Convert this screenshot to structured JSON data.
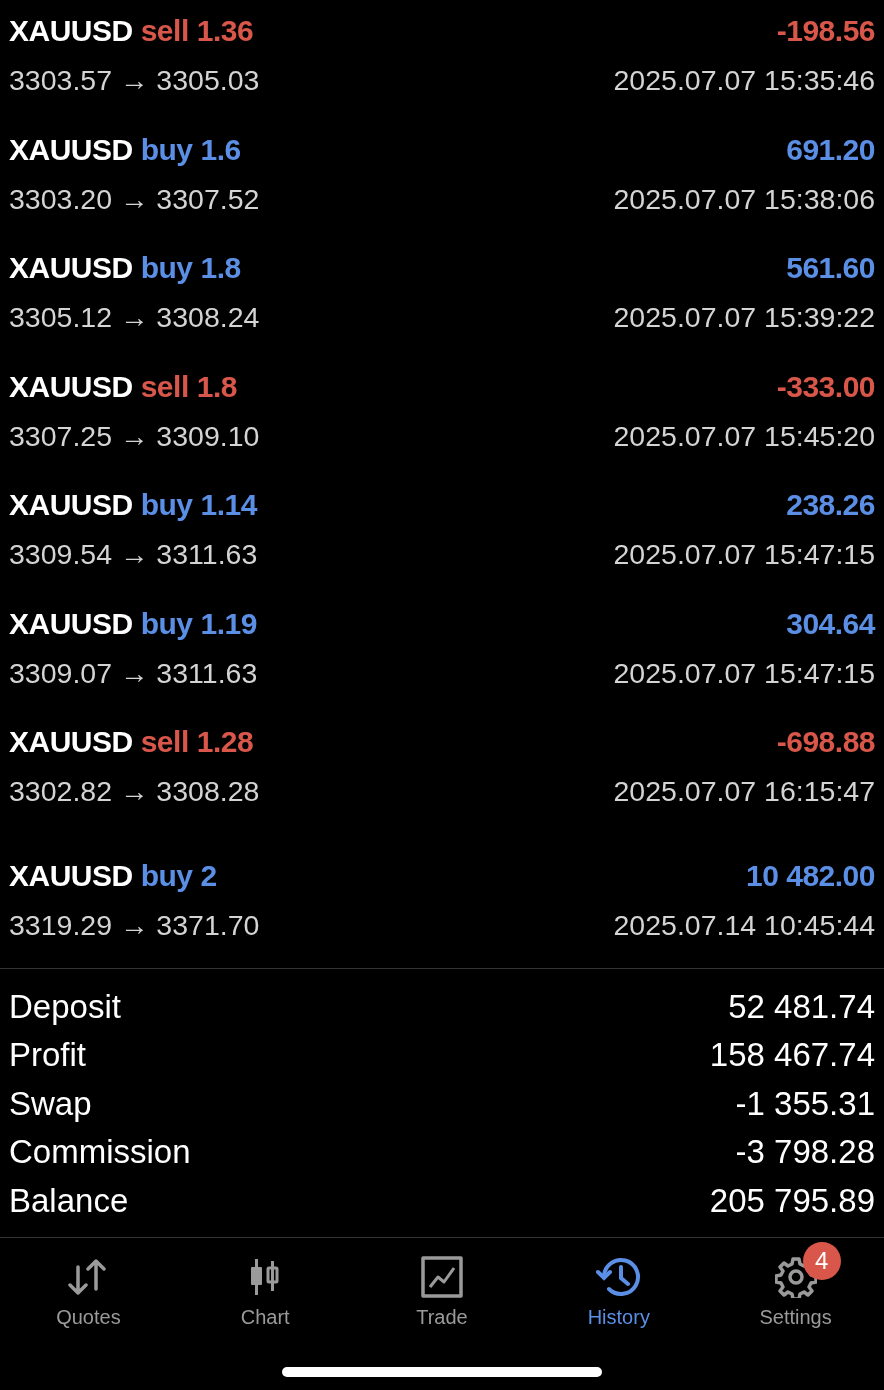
{
  "deals": [
    {
      "symbol": "XAUUSD",
      "side": "sell",
      "kind": "sell",
      "volume": "1.36",
      "profit": "-198.56",
      "prices": "3303.57 → 3305.03",
      "time": "2025.07.07 15:35:46"
    },
    {
      "symbol": "XAUUSD",
      "side": "buy",
      "kind": "buy",
      "volume": "1.6",
      "profit": "691.20",
      "prices": "3303.20 → 3307.52",
      "time": "2025.07.07 15:38:06"
    },
    {
      "symbol": "XAUUSD",
      "side": "buy",
      "kind": "buy",
      "volume": "1.8",
      "profit": "561.60",
      "prices": "3305.12 → 3308.24",
      "time": "2025.07.07 15:39:22"
    },
    {
      "symbol": "XAUUSD",
      "side": "sell",
      "kind": "sell",
      "volume": "1.8",
      "profit": "-333.00",
      "prices": "3307.25 → 3309.10",
      "time": "2025.07.07 15:45:20"
    },
    {
      "symbol": "XAUUSD",
      "side": "buy",
      "kind": "buy",
      "volume": "1.14",
      "profit": "238.26",
      "prices": "3309.54 → 3311.63",
      "time": "2025.07.07 15:47:15"
    },
    {
      "symbol": "XAUUSD",
      "side": "buy",
      "kind": "buy",
      "volume": "1.19",
      "profit": "304.64",
      "prices": "3309.07 → 3311.63",
      "time": "2025.07.07 15:47:15"
    },
    {
      "symbol": "XAUUSD",
      "side": "sell",
      "kind": "sell",
      "volume": "1.28",
      "profit": "-698.88",
      "prices": "3302.82 → 3308.28",
      "time": "2025.07.07 16:15:47"
    },
    {
      "symbol": "XAUUSD",
      "side": "buy",
      "kind": "buy",
      "volume": "2",
      "profit": "10 482.00",
      "prices": "3319.29 → 3371.70",
      "time": "2025.07.14 10:45:44"
    }
  ],
  "summary": [
    {
      "label": "Deposit",
      "value": "52 481.74"
    },
    {
      "label": "Profit",
      "value": "158 467.74"
    },
    {
      "label": "Swap",
      "value": "-1 355.31"
    },
    {
      "label": "Commission",
      "value": "-3 798.28"
    },
    {
      "label": "Balance",
      "value": "205 795.89"
    }
  ],
  "tabs": [
    {
      "label": "Quotes",
      "kind": "quotes",
      "selected": false
    },
    {
      "label": "Chart",
      "kind": "chart",
      "selected": false
    },
    {
      "label": "Trade",
      "kind": "trade",
      "selected": false
    },
    {
      "label": "History",
      "kind": "history",
      "selected": true
    },
    {
      "label": "Settings",
      "kind": "settings",
      "selected": false,
      "badge": "4"
    }
  ]
}
